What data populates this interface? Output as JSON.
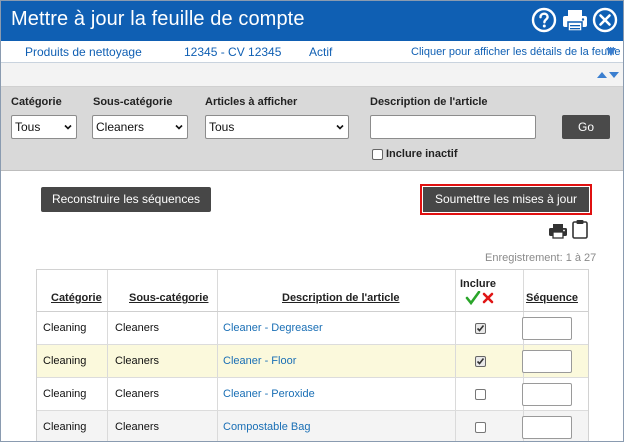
{
  "header": {
    "title": "Mettre à jour la feuille de compte",
    "bg_color": "#0f5fb3"
  },
  "info": {
    "category": "Produits de nettoyage",
    "account": "12345 - CV 12345",
    "status": "Actif",
    "details_link": "Cliquer pour afficher les détails de la feuille"
  },
  "filters": {
    "category_label": "Catégorie",
    "category_value": "Tous",
    "subcategory_label": "Sous-catégorie",
    "subcategory_value": "Cleaners",
    "articles_label": "Articles à afficher",
    "articles_value": "Tous",
    "description_label": "Description de l'article",
    "description_value": "",
    "go_label": "Go",
    "inactive_label": "Inclure inactif",
    "inactive_checked": false
  },
  "actions": {
    "rebuild_label": "Reconstruire les séquences",
    "submit_label": "Soumettre les mises à jour",
    "record_text": "Enregistrement: 1 à 27"
  },
  "table": {
    "headers": {
      "category": "Catégorie",
      "subcategory": "Sous-catégorie",
      "description": "Description de l'article",
      "include": "Inclure",
      "sequence": "Séquence"
    },
    "rows": [
      {
        "category": "Cleaning",
        "subcategory": "Cleaners",
        "description": "Cleaner - Degreaser",
        "include": true,
        "sequence": ""
      },
      {
        "category": "Cleaning",
        "subcategory": "Cleaners",
        "description": "Cleaner - Floor",
        "include": true,
        "sequence": ""
      },
      {
        "category": "Cleaning",
        "subcategory": "Cleaners",
        "description": "Cleaner - Peroxide",
        "include": false,
        "sequence": ""
      },
      {
        "category": "Cleaning",
        "subcategory": "Cleaners",
        "description": "Compostable Bag",
        "include": false,
        "sequence": ""
      }
    ]
  },
  "icons": {
    "help": "help-icon",
    "print": "printer-icon",
    "close": "close-icon",
    "clipboard": "clipboard-icon"
  }
}
